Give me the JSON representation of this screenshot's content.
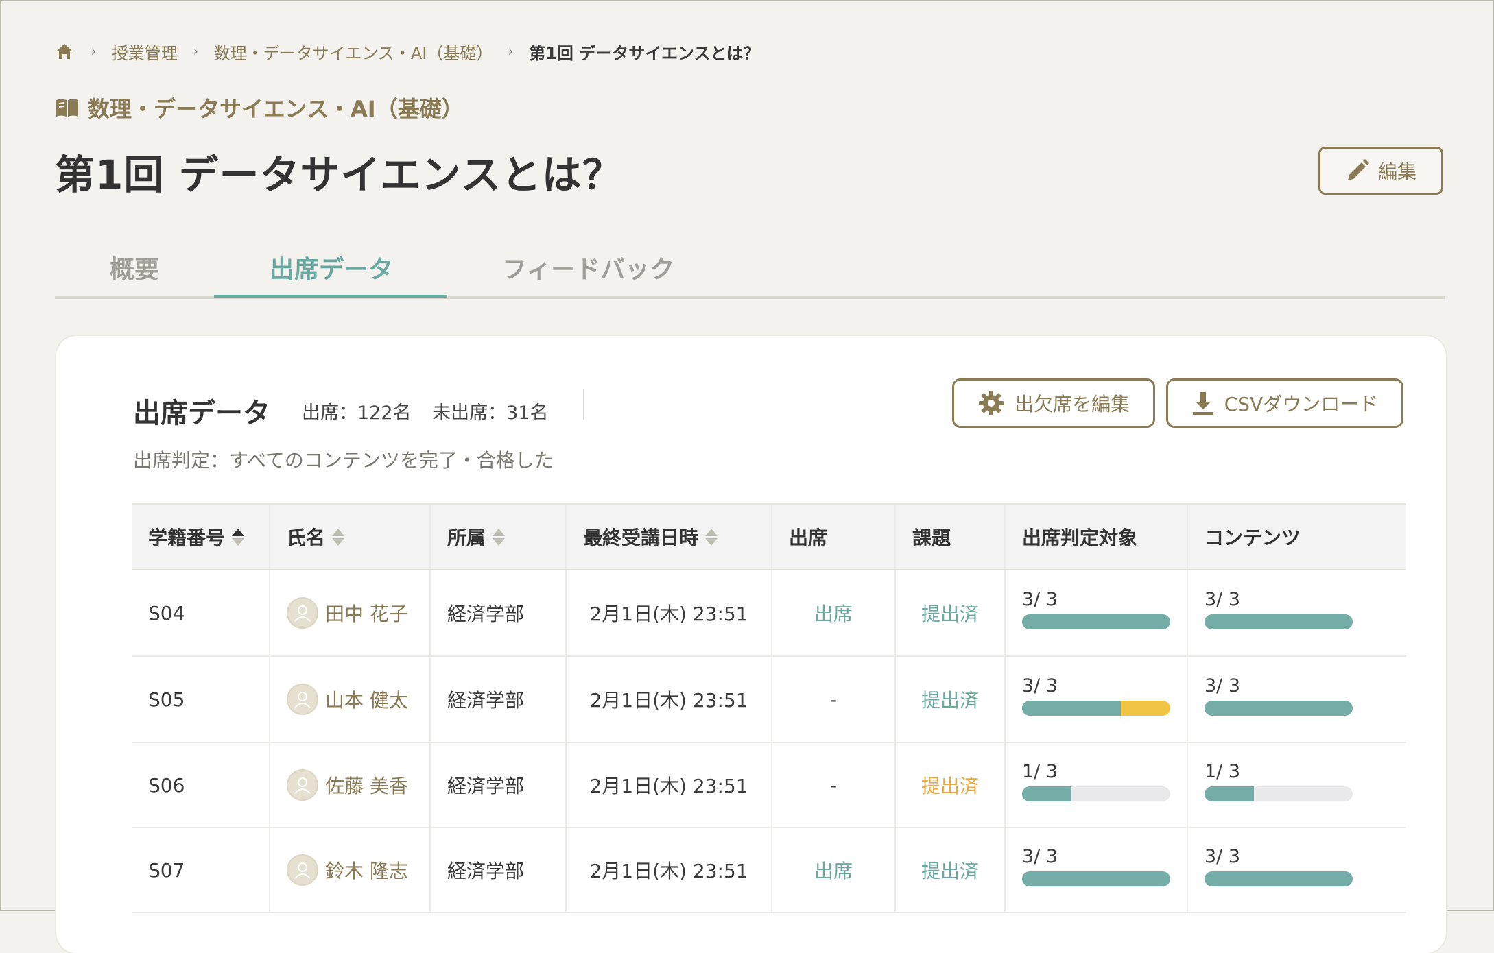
{
  "breadcrumb": {
    "home_icon": "home-icon",
    "items": [
      "授業管理",
      "数理・データサイエンス・AI（基礎）"
    ],
    "current": "第1回 データサイエンスとは？"
  },
  "course": {
    "icon": "book-icon",
    "title": "数理・データサイエンス・AI（基礎）"
  },
  "page_title": "第1回 データサイエンスとは？",
  "edit_button": {
    "icon": "pencil-icon",
    "label": "編集"
  },
  "tabs": [
    {
      "label": "概要",
      "active": false
    },
    {
      "label": "出席データ",
      "active": true
    },
    {
      "label": "フィードバック",
      "active": false
    }
  ],
  "attendance": {
    "title": "出席データ",
    "present": "出席：122名",
    "absent": "未出席：31名",
    "criteria": "出席判定：すべてのコンテンツを完了・合格した",
    "edit_attendance_label": "出欠席を編集",
    "csv_label": "CSVダウンロード"
  },
  "table": {
    "headers": [
      "学籍番号",
      "氏名",
      "所属",
      "最終受講日時",
      "出席",
      "課題",
      "出席判定対象",
      "コンテンツ"
    ],
    "rows": [
      {
        "id": "S04",
        "name": "田中 花子",
        "dept": "経済学部",
        "last": "2月1日(木) 23:51",
        "attendance": "出席",
        "assignment": "提出済",
        "assignment_status": "done",
        "target": "3/ 3",
        "target_done": 3,
        "target_partial": 0,
        "content": "3/ 3",
        "content_done": 3
      },
      {
        "id": "S05",
        "name": "山本 健太",
        "dept": "経済学部",
        "last": "2月1日(木) 23:51",
        "attendance": "-",
        "assignment": "提出済",
        "assignment_status": "done",
        "target": "3/ 3",
        "target_done": 2,
        "target_partial": 1,
        "content": "3/ 3",
        "content_done": 3
      },
      {
        "id": "S06",
        "name": "佐藤 美香",
        "dept": "経済学部",
        "last": "2月1日(木) 23:51",
        "attendance": "-",
        "assignment": "提出済",
        "assignment_status": "warning",
        "target": "1/ 3",
        "target_done": 1,
        "target_partial": 0,
        "content": "1/ 3",
        "content_done": 1
      },
      {
        "id": "S07",
        "name": "鈴木 隆志",
        "dept": "経済学部",
        "last": "2月1日(木) 23:51",
        "attendance": "出席",
        "assignment": "提出済",
        "assignment_status": "done",
        "target": "3/ 3",
        "target_done": 3,
        "target_partial": 0,
        "content": "3/ 3",
        "content_done": 3
      }
    ],
    "total": 3
  },
  "colors": {
    "accent": "#6aa8a2",
    "brand": "#8a7b55",
    "warning": "#e8a942",
    "partial": "#f2c443"
  }
}
